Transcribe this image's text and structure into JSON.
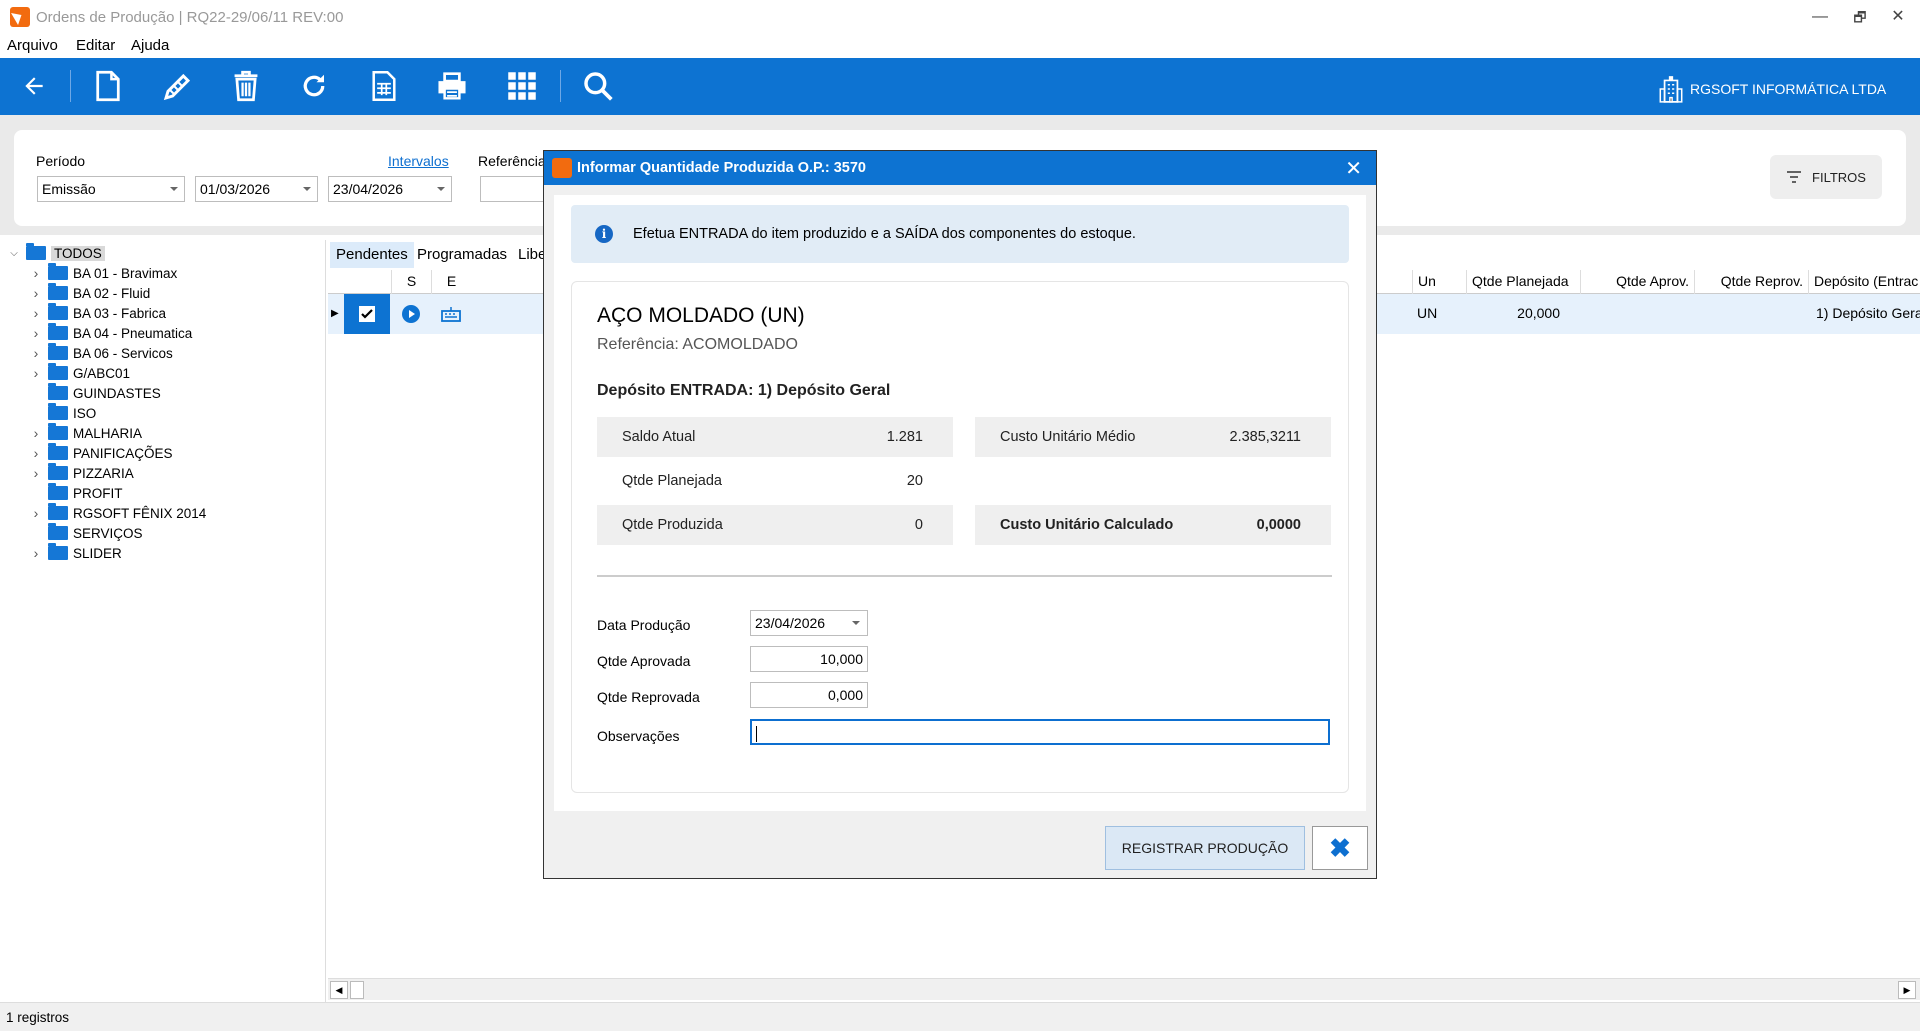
{
  "window": {
    "title": "Ordens de Produção | RQ22-29/06/11 REV:00",
    "minimize": "—",
    "restore": "🗗",
    "close": "✕"
  },
  "menu": [
    "Arquivo",
    "Editar",
    "Ajuda"
  ],
  "toolbar": {
    "company": "RGSOFT INFORMÁTICA LTDA",
    "accent": "#0d73d2"
  },
  "filters": {
    "period_label": "Período",
    "period_type": "Emissão",
    "date_from": "01/03/2026",
    "date_to": "23/04/2026",
    "intervals_link": "Intervalos",
    "reference_label": "Referência",
    "filters_button": "FILTROS"
  },
  "tree": {
    "root": "TODOS",
    "items": [
      {
        "label": "BA 01 - Bravimax",
        "expandable": true
      },
      {
        "label": "BA 02 - Fluid",
        "expandable": true
      },
      {
        "label": "BA 03 - Fabrica",
        "expandable": true
      },
      {
        "label": "BA 04 - Pneumatica",
        "expandable": true
      },
      {
        "label": "BA 06 - Servicos",
        "expandable": true
      },
      {
        "label": "G/ABC01",
        "expandable": true
      },
      {
        "label": "GUINDASTES",
        "expandable": false
      },
      {
        "label": "ISO",
        "expandable": false
      },
      {
        "label": "MALHARIA",
        "expandable": true
      },
      {
        "label": "PANIFICAÇÕES",
        "expandable": true
      },
      {
        "label": "PIZZARIA",
        "expandable": true
      },
      {
        "label": "PROFIT",
        "expandable": false
      },
      {
        "label": "RGSOFT FÊNIX 2014",
        "expandable": true
      },
      {
        "label": "SERVIÇOS",
        "expandable": false
      },
      {
        "label": "SLIDER",
        "expandable": true
      }
    ]
  },
  "grid": {
    "tabs": [
      "Pendentes",
      "Programadas",
      "Libe"
    ],
    "headers": {
      "s": "S",
      "e": "E",
      "un": "Un",
      "qtde_planejada": "Qtde Planejada",
      "qtde_aprov": "Qtde Aprov.",
      "qtde_reprov": "Qtde Reprov.",
      "deposito": "Depósito (Entrac"
    },
    "row": {
      "un": "UN",
      "qtde_planejada": "20,000",
      "qtde_aprov": "",
      "qtde_reprov": "",
      "deposito": "1) Depósito Gera"
    }
  },
  "status": {
    "records": "1 registros"
  },
  "modal": {
    "title": "Informar Quantidade Produzida O.P.: 3570",
    "info": "Efetua ENTRADA do item produzido e a SAÍDA dos componentes do estoque.",
    "product_name": "AÇO MOLDADO (UN)",
    "reference": "Referência: ACOMOLDADO",
    "deposit": "Depósito ENTRADA: 1) Depósito Geral",
    "stats": {
      "saldo_atual_label": "Saldo Atual",
      "saldo_atual_value": "1.281",
      "qtde_planejada_label": "Qtde Planejada",
      "qtde_planejada_value": "20",
      "qtde_produzida_label": "Qtde Produzida",
      "qtde_produzida_value": "0",
      "custo_medio_label": "Custo Unitário Médio",
      "custo_medio_value": "2.385,3211",
      "custo_calc_label": "Custo Unitário Calculado",
      "custo_calc_value": "0,0000"
    },
    "form": {
      "data_producao_label": "Data Produção",
      "data_producao_value": "23/04/2026",
      "qtde_aprovada_label": "Qtde Aprovada",
      "qtde_aprovada_value": "10,000",
      "qtde_reprovada_label": "Qtde Reprovada",
      "qtde_reprovada_value": "0,000",
      "observacoes_label": "Observações",
      "observacoes_value": ""
    },
    "register_button": "REGISTRAR PRODUÇÃO"
  }
}
